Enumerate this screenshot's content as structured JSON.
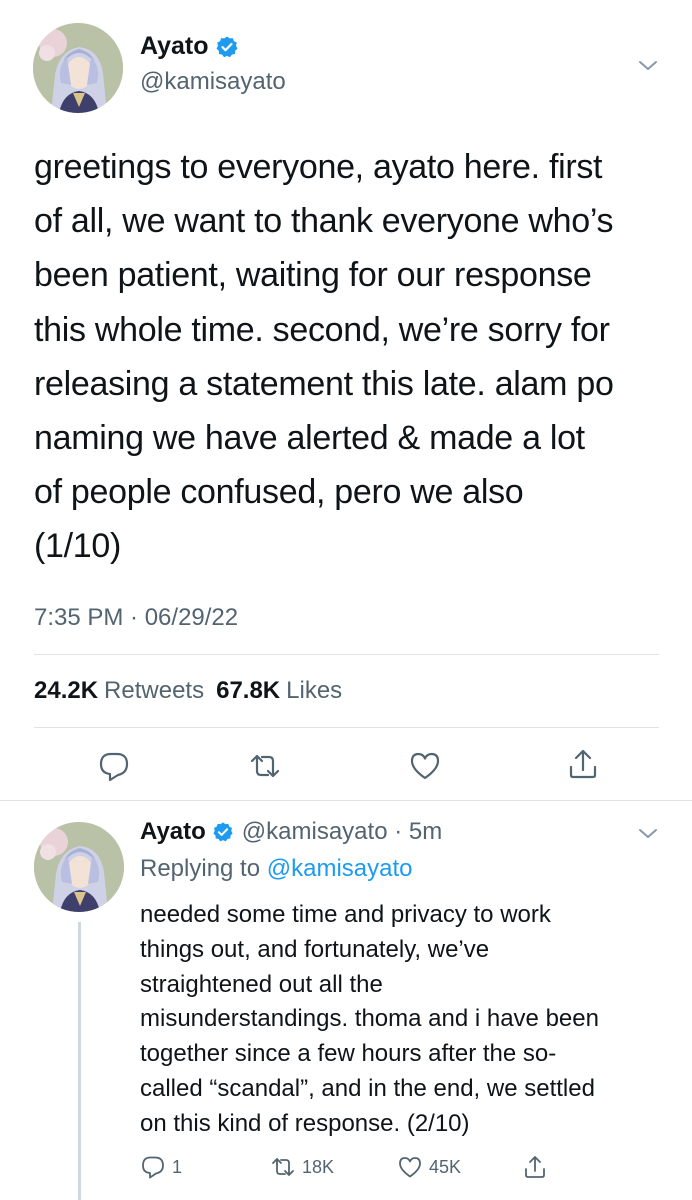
{
  "main_tweet": {
    "author_name": "Ayato",
    "handle": "@kamisayato",
    "verified": true,
    "text": "greetings to everyone, ayato here. first\nof all, we want to thank everyone who’s\nbeen patient, waiting for our response\nthis whole time. second, we’re sorry for\nreleasing a statement this late. alam po\nnaming we have alerted & made a lot\nof people confused, pero we also\n(1/10)",
    "timestamp": "7:35 PM · 06/29/22",
    "retweets_count": "24.2K",
    "retweets_label": "Retweets",
    "likes_count": "67.8K",
    "likes_label": "Likes",
    "actions": [
      "reply-icon",
      "retweet-icon",
      "like-icon",
      "share-icon"
    ]
  },
  "reply_tweet": {
    "author_name": "Ayato",
    "handle_time": "@kamisayato · 5m",
    "verified": true,
    "replying_to_prefix": "Replying to",
    "replying_to_handle": "@kamisayato",
    "text": "needed some time and privacy to work\nthings out, and fortunately, we’ve\nstraightened out all the\nmisunderstandings. thoma and i have been\ntogether since a few hours after the so-\ncalled “scandal”, and in the end, we settled\non this kind of response. (2/10)",
    "reply_count": "1",
    "retweet_count": "18K",
    "like_count": "45K"
  },
  "colors": {
    "text_primary": "#0f1419",
    "text_secondary": "#536471",
    "accent": "#1d9bf0",
    "divider": "#dfe3e6",
    "verified": "#1d9bf0"
  }
}
